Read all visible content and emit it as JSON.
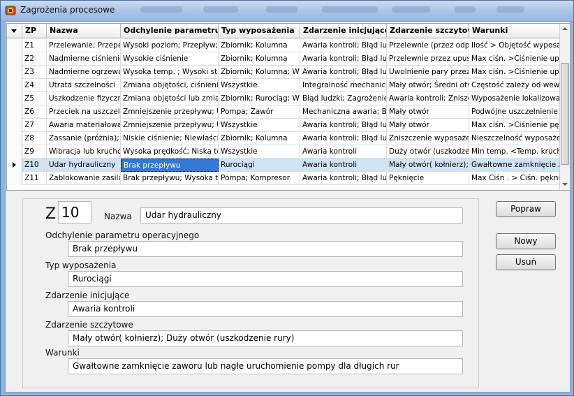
{
  "window": {
    "title": "Zagrożenia procesowe"
  },
  "grid": {
    "columns": [
      "ZP",
      "Nazwa",
      "Odchylenie parametru o",
      "Typ wyposażenia",
      "Zdarzenie inicjujące",
      "Zdarzenie szczytowe",
      "Warunki"
    ],
    "rows": [
      [
        "Z1",
        "Przelewanie; Przepełn",
        "Wysoki poziom; Przepływ; P",
        "Zbiornik; Kolumna",
        "Awaria kontroli; Błąd ludzk",
        "Przelewnie (przez odpo",
        "Ilość > Objętość wyposa..."
      ],
      [
        "Z2",
        "Nadmierne ciśnienie",
        "Wysokie ciśnienie",
        "Zbiornik; Kolumna",
        "Awaria kontroli; Błąd ludzk",
        "Przelewnie przez upust",
        "Max ciśn. >Ciśnienie upu..."
      ],
      [
        "Z3",
        "Nadmierne ogrzewar",
        "Wysoka temp. ; Wysoki stru",
        "Zbiornik; Kolumna; Wyn",
        "Awaria kontroli; Błąd ludzk",
        "Uwolnienie pary przez u",
        "Max ciśn. >Ciśnienie upu..."
      ],
      [
        "Z4",
        "Utrata szczelności",
        "Zmiana objętości, ciśnienia la",
        "Wszystkie",
        "Integralność mechaniczn",
        "Mały otwór; Średni otw",
        "Częstość zależy od wew..."
      ],
      [
        "Z5",
        "Uszkodzenie fizyczne",
        "Zmiana objętości lub zmiana",
        "Zbiornik; Rurociąg; Wą",
        "Błąd ludzki; Zagrożenie r",
        "Awaria kontroli; Zniszcz",
        "Wyposażenie lokalizowa..."
      ],
      [
        "Z6",
        "Przeciek na uszczelni",
        "Zmniejszenie przepływu; Ut",
        "Pompa; Zawór",
        "Mechaniczna awaria; Błą",
        "Mały otwór",
        "Podwójne uszczelnienie :."
      ],
      [
        "Z7",
        "Awaria materiałowa;",
        "Zmniejszenie przepływu; Ut",
        "Wszystkie",
        "Awaria kontroli; Błąd ludzk",
        "Mały otwór",
        "Max ciśn. >Ciśnienie pęk..."
      ],
      [
        "Z8",
        "Zassanie (próżnia); z",
        "Niskie ciśnienie; Niewłaściwy",
        "Zbiornik; Kolumna",
        "Awaria kontroli; Błąd ludzk",
        "Zniszczenie wyposażen",
        "Nieszczelność wyposaże..."
      ],
      [
        "Z9",
        "Wibracja lub kruchość",
        "Wysoka prędkość; Niska tem",
        "Wszystkie",
        "Awaria kontroli",
        "Duży otwór (uszkodzen",
        "Min temp. <Temp. kruch..."
      ],
      [
        "Z10",
        "Udar hydrauliczny",
        "Brak przepływu",
        "Rurociągi",
        "Awaria kontroli",
        "Mały otwór( kołnierz); I",
        "Gwałtowne zamknięcie z..."
      ],
      [
        "Z11",
        "Zablokowanie zasilani",
        "Brak przepływu; Wysoka tem",
        "Pompa; Kompresor",
        "Awaria kontroli; Błąd ludzk",
        "Pęknięcie",
        "Max Ciśn . > Ciśn. pękni"
      ]
    ]
  },
  "form": {
    "z_label": "Z",
    "z_value": "10",
    "nazwa_label": "Nazwa",
    "nazwa_value": "Udar hydrauliczny",
    "odchylenie_label": "Odchylenie parametru operacyjnego",
    "odchylenie_value": "Brak przepływu",
    "typ_label": "Typ wyposażenia",
    "typ_value": "Rurociągi",
    "inicjujace_label": "Zdarzenie inicjujące",
    "inicjujace_value": "Awaria kontroli",
    "szczytowe_label": "Zdarzenie szczytowe",
    "szczytowe_value": "Mały otwór( kołnierz); Duży otwór (uszkodzenie rury)",
    "warunki_label": "Warunki",
    "warunki_value": "Gwałtowne zamknięcie zaworu lub nagłe uruchomienie pompy dla długich rur"
  },
  "buttons": {
    "popraw": "Popraw",
    "nowy": "Nowy",
    "usun": "Usuń"
  },
  "colors": {
    "selection": "#3478d4",
    "selected_row": "#cfe3f5",
    "frame": "#8fb3dc"
  }
}
